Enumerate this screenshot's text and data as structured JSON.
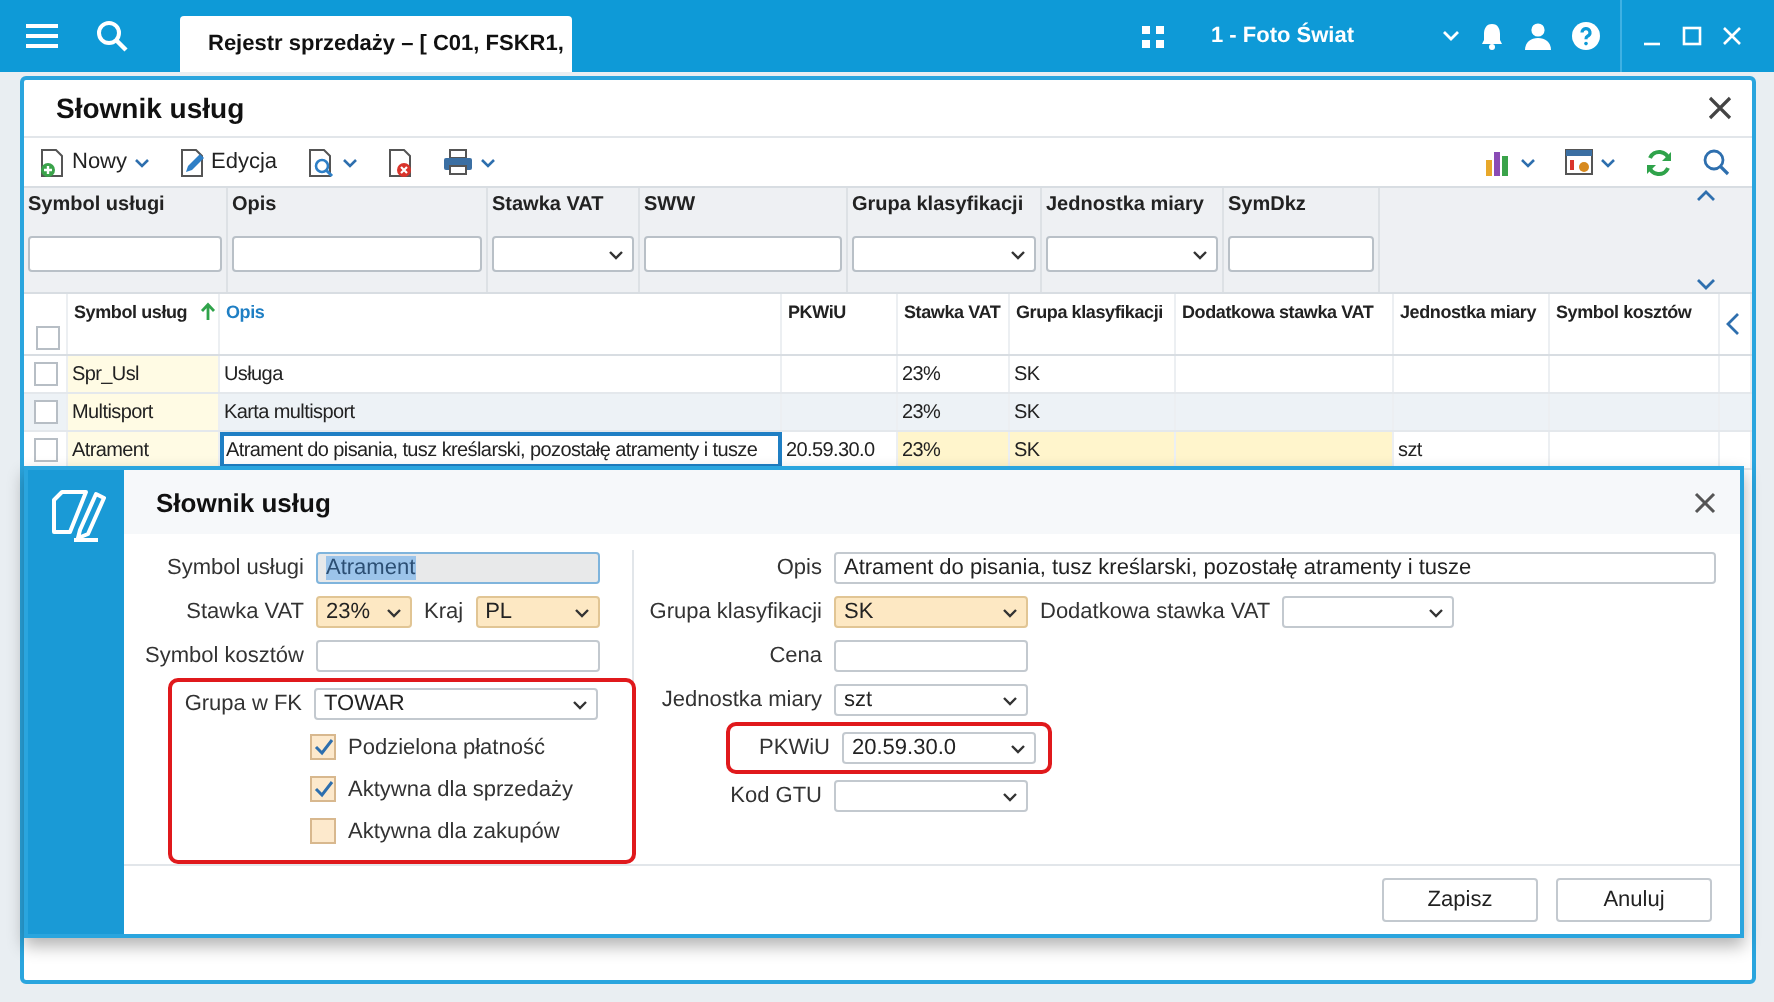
{
  "topbar": {
    "tab_title": "Rejestr sprzedaży – [ C01, FSKR1,",
    "company": "1 - Foto Świat"
  },
  "window": {
    "title": "Słownik usług"
  },
  "toolbar": [
    {
      "kind": "new",
      "label": "Nowy",
      "dropdown": true
    },
    {
      "kind": "edit",
      "label": "Edycja",
      "dropdown": false
    },
    {
      "kind": "preview",
      "dropdown": true
    },
    {
      "kind": "delete",
      "dropdown": false
    },
    {
      "kind": "print",
      "dropdown": true
    }
  ],
  "toolbar_right": [
    {
      "kind": "chart",
      "dropdown": true
    },
    {
      "kind": "settings",
      "dropdown": true
    },
    {
      "kind": "refresh",
      "dropdown": false
    },
    {
      "kind": "search",
      "dropdown": false
    }
  ],
  "filters": [
    {
      "label": "Symbol usługi",
      "kind": "text"
    },
    {
      "label": "Opis",
      "kind": "text"
    },
    {
      "label": "Stawka VAT",
      "kind": "select"
    },
    {
      "label": "SWW",
      "kind": "text"
    },
    {
      "label": "Grupa klasyfikacji",
      "kind": "select"
    },
    {
      "label": "Jednostka miary",
      "kind": "select"
    },
    {
      "label": "SymDkz",
      "kind": "text"
    }
  ],
  "table": {
    "all_checked": false,
    "columns": [
      {
        "label": "Symbol usług",
        "sorted": true,
        "active": false,
        "required": false
      },
      {
        "label": "Opis",
        "sorted": false,
        "active": true,
        "required": false
      },
      {
        "label": "PKWiU",
        "sorted": false,
        "active": false,
        "required": false
      },
      {
        "label": "Stawka VAT",
        "sorted": false,
        "active": false,
        "required": true
      },
      {
        "label": "Grupa klasyfikacji",
        "sorted": false,
        "active": false,
        "required": true
      },
      {
        "label": "Dodatkowa stawka VAT",
        "sorted": false,
        "active": false,
        "required": true
      },
      {
        "label": "Jednostka miary",
        "sorted": false,
        "active": false,
        "required": false
      },
      {
        "label": "Symbol kosztów",
        "sorted": false,
        "active": false,
        "required": false
      }
    ],
    "rows": [
      {
        "checked": false,
        "current": false,
        "cells": [
          "Spr_Usl",
          "Usługa",
          null,
          "23%",
          "SK",
          null,
          null,
          null
        ]
      },
      {
        "checked": false,
        "current": false,
        "cells": [
          "Multisport",
          "Karta multisport",
          null,
          "23%",
          "SK",
          null,
          null,
          null
        ]
      },
      {
        "checked": false,
        "current": true,
        "cells": [
          "Atrament",
          "Atrament do pisania, tusz kreślarski, pozostałę atramenty i tusze",
          "20.59.30.0",
          "23%",
          "SK",
          null,
          "szt",
          null
        ]
      }
    ]
  },
  "dialog": {
    "title": "Słownik usług",
    "left": [
      {
        "kind": "text",
        "label": "Symbol usługi",
        "value": "Atrament",
        "disabled": true,
        "text_selected": true
      },
      {
        "kind": "select",
        "label": "Stawka VAT",
        "value": "23%",
        "required": true,
        "second": {
          "label": "Kraj",
          "value": "PL",
          "required": true
        }
      },
      {
        "kind": "text",
        "label": "Symbol kosztów"
      },
      {
        "kind": "group",
        "highlighted": true,
        "items": [
          {
            "kind": "select",
            "label": "Grupa w FK",
            "value": "TOWAR"
          },
          {
            "kind": "checkbox",
            "label": "Podzielona płatność",
            "checked": true
          },
          {
            "kind": "checkbox",
            "label": "Aktywna dla sprzedaży",
            "checked": true
          },
          {
            "kind": "checkbox",
            "label": "Aktywna dla zakupów",
            "checked": false
          }
        ]
      }
    ],
    "right": [
      {
        "kind": "text",
        "label": "Opis",
        "value": "Atrament do pisania, tusz kreślarski, pozostałę atramenty i tusze"
      },
      {
        "kind": "select",
        "label": "Grupa klasyfikacji",
        "value": "SK",
        "required": true,
        "second": {
          "label": "Dodatkowa stawka VAT"
        }
      },
      {
        "kind": "text",
        "label": "Cena"
      },
      {
        "kind": "select",
        "label": "Jednostka miary",
        "value": "szt"
      },
      {
        "kind": "group",
        "highlighted": true,
        "items": [
          {
            "kind": "select",
            "label": "PKWiU",
            "value": "20.59.30.0"
          }
        ]
      },
      {
        "kind": "select",
        "label": "Kod GTU"
      }
    ],
    "buttons": [
      "Zapisz",
      "Anuluj"
    ]
  }
}
